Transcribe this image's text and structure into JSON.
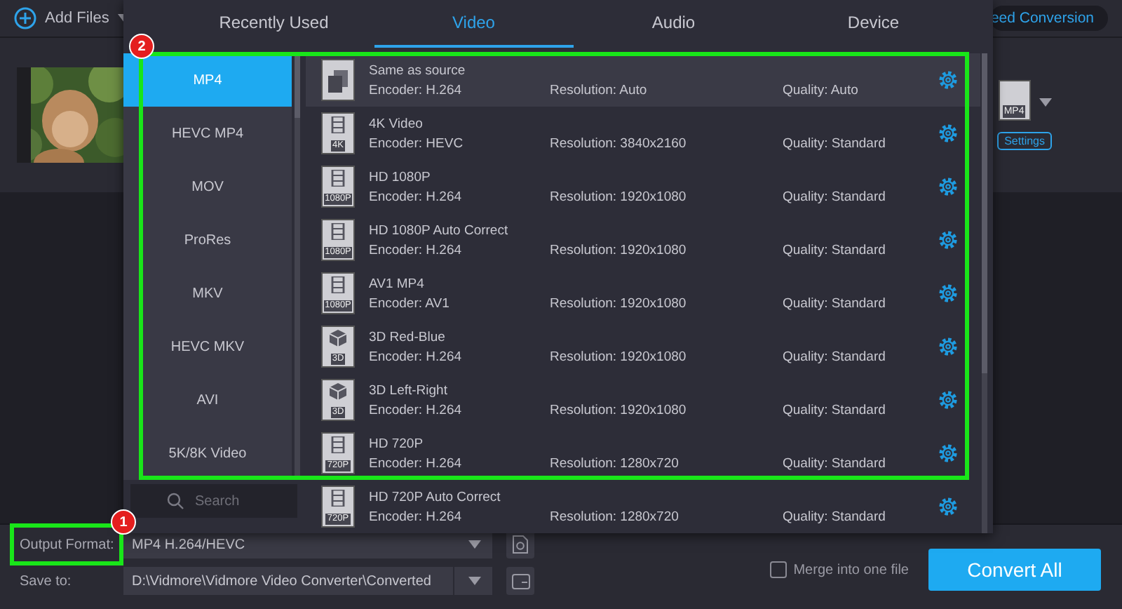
{
  "toolbar": {
    "add_files": "Add Files",
    "speed_conversion": "eed Conversion"
  },
  "file": {
    "format_badge": "MP4",
    "settings": "Settings"
  },
  "popup": {
    "tabs": [
      {
        "label": "Recently Used",
        "selected": false
      },
      {
        "label": "Video",
        "selected": true
      },
      {
        "label": "Audio",
        "selected": false
      },
      {
        "label": "Device",
        "selected": false
      }
    ],
    "categories": [
      {
        "label": "MP4",
        "selected": true
      },
      {
        "label": "HEVC MP4",
        "selected": false
      },
      {
        "label": "MOV",
        "selected": false
      },
      {
        "label": "ProRes",
        "selected": false
      },
      {
        "label": "MKV",
        "selected": false
      },
      {
        "label": "HEVC MKV",
        "selected": false
      },
      {
        "label": "AVI",
        "selected": false
      },
      {
        "label": "5K/8K Video",
        "selected": false
      }
    ],
    "search": {
      "placeholder": "Search"
    },
    "highlight_badge": "2",
    "presets": [
      {
        "kind": "copy",
        "name": "Same as source",
        "encoder": "Encoder: H.264",
        "resolution": "Resolution: Auto",
        "quality": "Quality: Auto",
        "selected": true
      },
      {
        "kind": "film",
        "badge": "4K",
        "name": "4K Video",
        "encoder": "Encoder: HEVC",
        "resolution": "Resolution: 3840x2160",
        "quality": "Quality: Standard",
        "selected": false
      },
      {
        "kind": "film",
        "badge": "1080P",
        "name": "HD 1080P",
        "encoder": "Encoder: H.264",
        "resolution": "Resolution: 1920x1080",
        "quality": "Quality: Standard",
        "selected": false
      },
      {
        "kind": "film",
        "badge": "1080P",
        "name": "HD 1080P Auto Correct",
        "encoder": "Encoder: H.264",
        "resolution": "Resolution: 1920x1080",
        "quality": "Quality: Standard",
        "selected": false
      },
      {
        "kind": "film",
        "badge": "1080P",
        "name": "AV1 MP4",
        "encoder": "Encoder: AV1",
        "resolution": "Resolution: 1920x1080",
        "quality": "Quality: Standard",
        "selected": false
      },
      {
        "kind": "cube",
        "badge": "3D",
        "name": "3D Red-Blue",
        "encoder": "Encoder: H.264",
        "resolution": "Resolution: 1920x1080",
        "quality": "Quality: Standard",
        "selected": false
      },
      {
        "kind": "cube",
        "badge": "3D",
        "name": "3D Left-Right",
        "encoder": "Encoder: H.264",
        "resolution": "Resolution: 1920x1080",
        "quality": "Quality: Standard",
        "selected": false
      },
      {
        "kind": "film",
        "badge": "720P",
        "name": "HD 720P",
        "encoder": "Encoder: H.264",
        "resolution": "Resolution: 1280x720",
        "quality": "Quality: Standard",
        "selected": false
      },
      {
        "kind": "film",
        "badge": "720P",
        "name": "HD 720P Auto Correct",
        "encoder": "Encoder: H.264",
        "resolution": "Resolution: 1280x720",
        "quality": "Quality: Standard",
        "selected": false
      }
    ]
  },
  "bottom": {
    "output_format": {
      "label": "Output Format:",
      "value": "MP4 H.264/HEVC",
      "highlight_badge": "1"
    },
    "save_to": {
      "label": "Save to:",
      "value": "D:\\Vidmore\\Vidmore Video Converter\\Converted"
    },
    "merge": {
      "label": "Merge into one file",
      "checked": false
    },
    "convert": "Convert All"
  }
}
